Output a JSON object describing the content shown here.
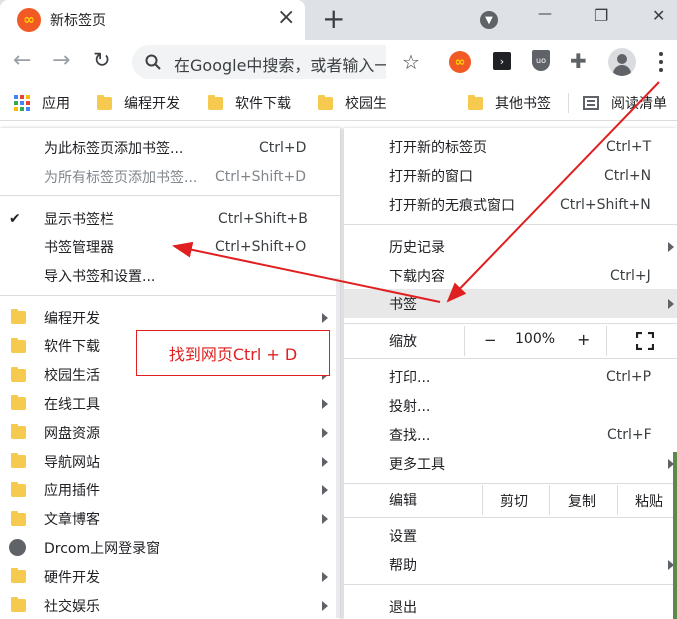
{
  "tab": {
    "title": "新标签页",
    "close": "×",
    "newtab": "+"
  },
  "window": {
    "minimize": "—",
    "restore": "❐",
    "close": "✕"
  },
  "toolbar": {
    "omnibox_placeholder": "在Google中搜索，或者输入一个网址"
  },
  "bookmarks_bar": {
    "items": [
      {
        "label": "应用",
        "icon": "apps-grid-icon"
      },
      {
        "label": "编程开发",
        "icon": "folder-icon"
      },
      {
        "label": "软件下载",
        "icon": "folder-icon"
      },
      {
        "label": "校园生",
        "icon": "folder-icon"
      },
      {
        "label": "其他书签",
        "icon": "folder-icon"
      },
      {
        "label": "阅读清单",
        "icon": "reading-list-icon"
      }
    ]
  },
  "left_menu": {
    "top": [
      {
        "label": "为此标签页添加书签...",
        "shortcut": "Ctrl+D",
        "disabled": false
      },
      {
        "label": "为所有标签页添加书签...",
        "shortcut": "Ctrl+Shift+D",
        "disabled": true
      }
    ],
    "mid": [
      {
        "label": "显示书签栏",
        "shortcut": "Ctrl+Shift+B",
        "checked": true
      },
      {
        "label": "书签管理器",
        "shortcut": "Ctrl+Shift+O"
      },
      {
        "label": "导入书签和设置...",
        "shortcut": ""
      }
    ],
    "folders": [
      {
        "label": "编程开发",
        "type": "folder"
      },
      {
        "label": "软件下载",
        "type": "folder"
      },
      {
        "label": "校园生活",
        "type": "folder"
      },
      {
        "label": "在线工具",
        "type": "folder"
      },
      {
        "label": "网盘资源",
        "type": "folder"
      },
      {
        "label": "导航网站",
        "type": "folder"
      },
      {
        "label": "应用插件",
        "type": "folder"
      },
      {
        "label": "文章博客",
        "type": "folder"
      },
      {
        "label": "Drcom上网登录窗",
        "type": "globe"
      },
      {
        "label": "硬件开发",
        "type": "folder"
      },
      {
        "label": "社交娱乐",
        "type": "folder"
      }
    ]
  },
  "annotation": {
    "text": "找到网页Ctrl + D",
    "color": "#e02020"
  },
  "main_menu": {
    "g1": [
      {
        "label": "打开新的标签页",
        "shortcut": "Ctrl+T"
      },
      {
        "label": "打开新的窗口",
        "shortcut": "Ctrl+N"
      },
      {
        "label": "打开新的无痕式窗口",
        "shortcut": "Ctrl+Shift+N"
      }
    ],
    "g2": [
      {
        "label": "历史记录",
        "shortcut": "",
        "submenu": true
      },
      {
        "label": "下载内容",
        "shortcut": "Ctrl+J"
      },
      {
        "label": "书签",
        "shortcut": "",
        "submenu": true,
        "highlighted": true
      }
    ],
    "zoom": {
      "label": "缩放",
      "minus": "−",
      "value": "100%",
      "plus": "+"
    },
    "g3": [
      {
        "label": "打印...",
        "shortcut": "Ctrl+P"
      },
      {
        "label": "投射...",
        "shortcut": ""
      },
      {
        "label": "查找...",
        "shortcut": "Ctrl+F"
      },
      {
        "label": "更多工具",
        "shortcut": "",
        "submenu": true
      }
    ],
    "edit": {
      "label": "编辑",
      "cut": "剪切",
      "copy": "复制",
      "paste": "粘贴"
    },
    "g4": [
      {
        "label": "设置",
        "shortcut": ""
      },
      {
        "label": "帮助",
        "shortcut": "",
        "submenu": true
      }
    ],
    "exit": {
      "label": "退出"
    }
  },
  "colors": {
    "accent": "#1a73e8",
    "arrow": "#e02020",
    "highlight": "#e8e8e9",
    "folder": "#f6c94f"
  }
}
